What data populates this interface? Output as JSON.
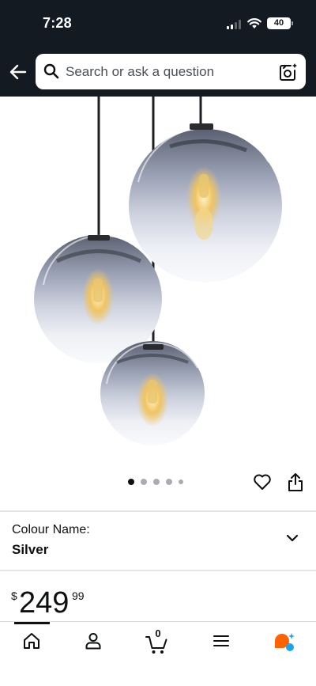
{
  "status_bar": {
    "time": "7:28",
    "battery_level": "40"
  },
  "search": {
    "placeholder": "Search or ask a question"
  },
  "gallery": {
    "image_count": 5,
    "active_image": 1
  },
  "variation": {
    "label": "Colour Name:",
    "value": "Silver"
  },
  "price": {
    "symbol": "$",
    "whole": "249",
    "fraction": "99"
  },
  "bottom_nav": {
    "cart_count": "0",
    "items": [
      "home-icon",
      "account-icon",
      "cart-icon",
      "menu-icon",
      "rufus-icon"
    ]
  },
  "colors": {
    "header_bg": "#131a22",
    "text": "#0f1111",
    "rufus_orange": "#ff6200",
    "rufus_blue": "#1aa6e8"
  }
}
